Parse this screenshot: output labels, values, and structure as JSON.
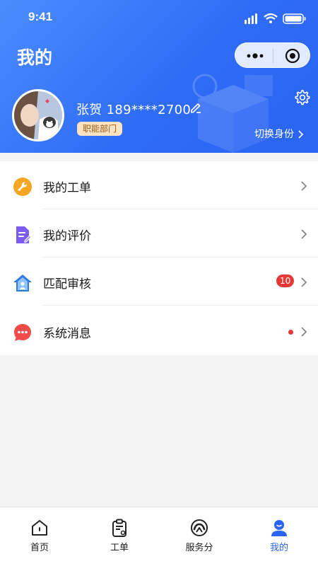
{
  "status_bar": {
    "time": "9:41"
  },
  "header": {
    "title": "我的",
    "user_name": "张贺 189****2700",
    "department_tag": "职能部门",
    "switch_identity_label": "切换身份"
  },
  "menu": {
    "items": [
      {
        "label": "我的工单",
        "icon": "wrench-icon",
        "icon_color": "#f5a623"
      },
      {
        "label": "我的评价",
        "icon": "document-edit-icon",
        "icon_color": "#7b5cf0"
      },
      {
        "label": "匹配审核",
        "icon": "house-person-icon",
        "icon_color": "#2f7de1",
        "badge": "10"
      },
      {
        "label": "系统消息",
        "icon": "chat-bubble-icon",
        "icon_color": "#ef4b4b",
        "has_dot": true
      }
    ]
  },
  "tabbar": {
    "active_index": 3,
    "items": [
      {
        "label": "首页",
        "icon": "home-icon"
      },
      {
        "label": "工单",
        "icon": "clipboard-icon"
      },
      {
        "label": "服务分",
        "icon": "score-gauge-icon"
      },
      {
        "label": "我的",
        "icon": "user-icon"
      }
    ]
  },
  "colors": {
    "header_gradient_start": "#4a8dff",
    "header_gradient_end": "#2a64f2",
    "accent": "#2a64f2",
    "badge_red": "#e53935",
    "tag_bg": "#fbe3c2",
    "tag_text": "#9a5a17"
  }
}
